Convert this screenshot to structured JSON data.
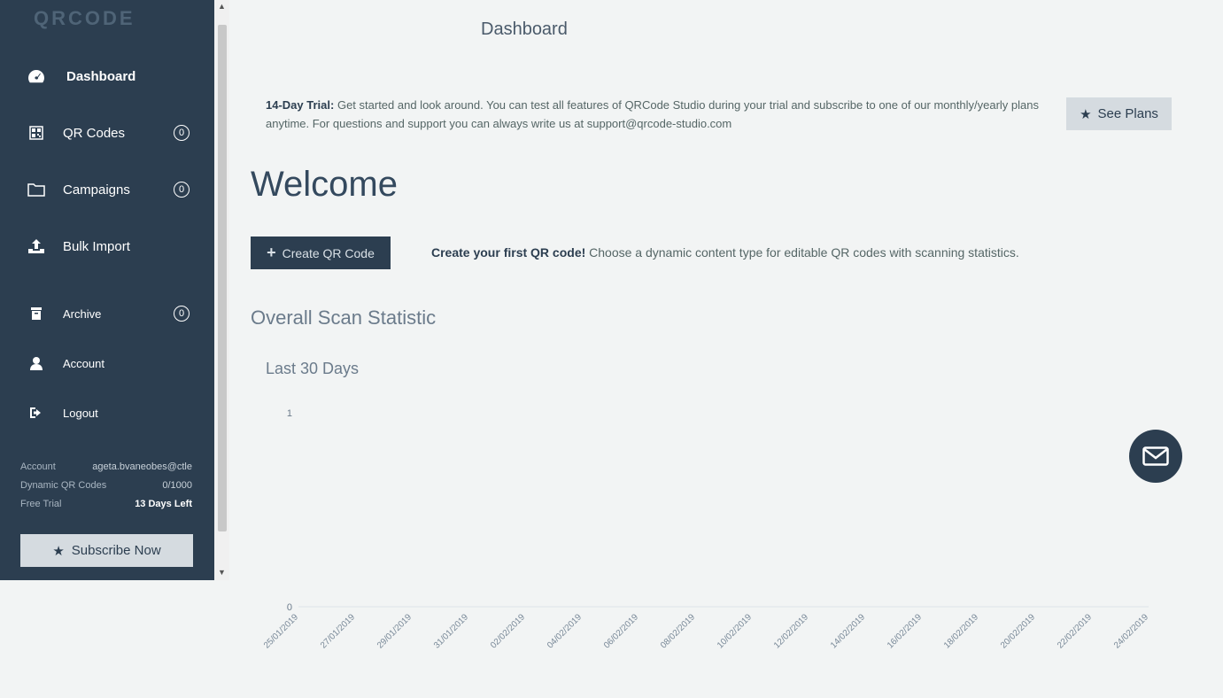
{
  "sidebar": {
    "logo": "QRCODE",
    "nav": {
      "dashboard": "Dashboard",
      "qr_codes": "QR Codes",
      "qr_codes_count": "0",
      "campaigns": "Campaigns",
      "campaigns_count": "0",
      "bulk_import": "Bulk Import",
      "archive": "Archive",
      "archive_count": "0",
      "account": "Account",
      "logout": "Logout"
    },
    "info": {
      "account_label": "Account",
      "account_value": "ageta.bvaneobes@ctle",
      "dynamic_label": "Dynamic QR Codes",
      "dynamic_value": "0/1000",
      "trial_label": "Free Trial",
      "trial_value": "13 Days Left"
    },
    "subscribe_label": "Subscribe Now"
  },
  "header": {
    "title": "Dashboard"
  },
  "trial": {
    "bold": "14-Day Trial:",
    "text": "Get started and look around. You can test all features of QRCode Studio during your trial and subscribe to one of our monthly/yearly plans anytime. For questions and support you can always write us at support@qrcode-studio.com",
    "see_plans": "See Plans"
  },
  "welcome": "Welcome",
  "create": {
    "button": "Create QR Code",
    "bold": "Create your first QR code!",
    "text": "Choose a dynamic content type for editable QR codes with scanning statistics."
  },
  "stats": {
    "heading": "Overall Scan Statistic",
    "subheading": "Last 30 Days"
  },
  "chart_data": {
    "type": "line",
    "title": "",
    "x": [
      "25/01/2019",
      "27/01/2019",
      "29/01/2019",
      "31/01/2019",
      "02/02/2019",
      "04/02/2019",
      "06/02/2019",
      "08/02/2019",
      "10/02/2019",
      "12/02/2019",
      "14/02/2019",
      "16/02/2019",
      "18/02/2019",
      "20/02/2019",
      "22/02/2019",
      "24/02/2019"
    ],
    "series": [
      {
        "values": [
          0,
          0,
          0,
          0,
          0,
          0,
          0,
          0,
          0,
          0,
          0,
          0,
          0,
          0,
          0,
          0
        ]
      }
    ],
    "yticks": [
      "1",
      "0"
    ],
    "ylim": [
      0,
      1
    ],
    "xlabel": "",
    "ylabel": "",
    "grid": false
  },
  "colors": {
    "sidebar": "#2c3e50",
    "background": "#f2f4f4",
    "button_light": "#d5dbe0"
  },
  "icons": [
    "dashboard-icon",
    "qrcode-icon",
    "folder-icon",
    "upload-icon",
    "archive-icon",
    "user-icon",
    "logout-icon",
    "star-icon",
    "plus-icon",
    "envelope-icon"
  ]
}
